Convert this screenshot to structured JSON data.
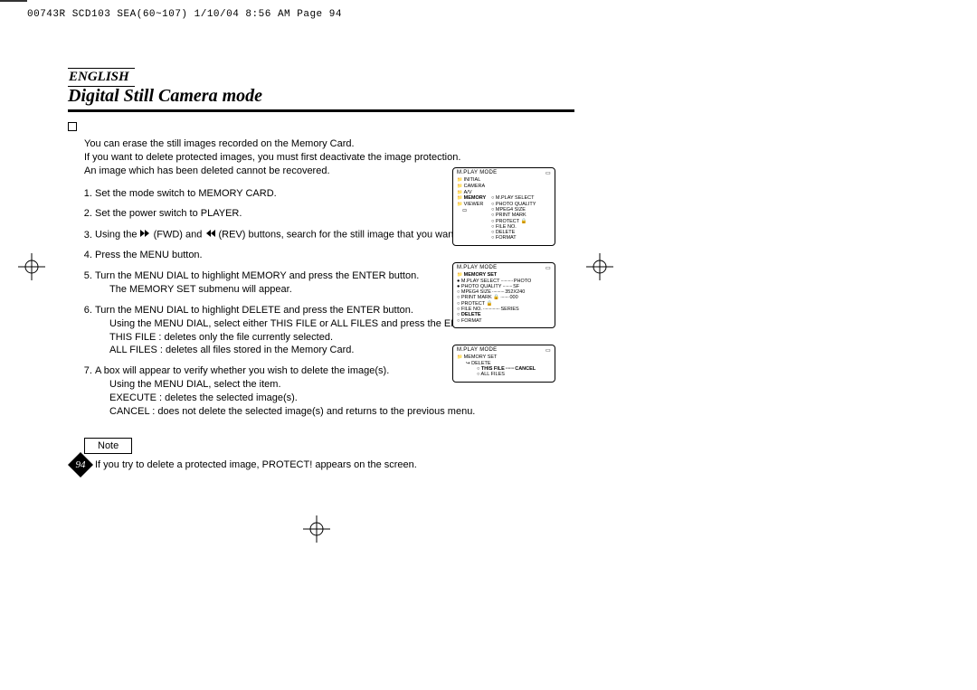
{
  "print_header": "00743R SCD103 SEA(60~107)   1/10/04 8:56 AM  Page 94",
  "language_label": "ENGLISH",
  "title": "Digital Still Camera mode",
  "intro_lines": [
    "You can erase the still images recorded on the Memory Card.",
    "If you want to delete protected images, you must first deactivate the image protection.",
    "An image which has been deleted cannot be recovered."
  ],
  "steps": {
    "s1": "Set the mode switch to MEMORY CARD.",
    "s2": "Set the power switch to PLAYER.",
    "s3_pre": "Using the ",
    "s3_fwd": "(FWD) and ",
    "s3_rev": "(REV) buttons, search for the still image that you want to delete.",
    "s4": "Press the MENU button.",
    "s5": "Turn the MENU DIAL to highlight MEMORY and press the ENTER button.",
    "s5_sub": "The MEMORY SET submenu will appear.",
    "s6": "Turn the MENU DIAL to highlight DELETE and press the ENTER button.",
    "s6_sub1": "Using the MENU DIAL, select either THIS FILE or ALL FILES and press the ENTER button.",
    "s6_sub2": "THIS FILE : deletes only the file currently selected.",
    "s6_sub3": "ALL FILES : deletes all files stored in the Memory Card.",
    "s7": "A box will appear to verify whether you wish to delete the image(s).",
    "s7_sub1": "Using the MENU DIAL, select the item.",
    "s7_sub2": "EXECUTE : deletes the selected image(s).",
    "s7_sub3": "CANCEL : does not delete the selected image(s) and returns to the previous menu."
  },
  "note_label": "Note",
  "note_text": "If you try to delete a protected image,  PROTECT!  appears on the screen.",
  "page_number": "94",
  "osd1": {
    "title": "M.PLAY MODE",
    "left_items": [
      "INITIAL",
      "CAMERA",
      "A/V"
    ],
    "memory_label": "MEMORY",
    "viewer_label": "VIEWER",
    "right_items": [
      "M.PLAY SELECT",
      "PHOTO QUALITY",
      "MPEG4 SIZE",
      "PRINT MARK",
      "PROTECT",
      "FILE NO.",
      "DELETE",
      "FORMAT"
    ]
  },
  "osd2": {
    "title": "M.PLAY MODE",
    "header": "MEMORY SET",
    "rows": [
      {
        "label": "M.PLAY SELECT",
        "value": "PHOTO"
      },
      {
        "label": "PHOTO QUALITY",
        "value": "SF"
      },
      {
        "label": "MPEG4 SIZE",
        "value": "352X240"
      },
      {
        "label": "PRINT MARK",
        "value": "000",
        "icon": "lock"
      },
      {
        "label": "PROTECT",
        "value": "",
        "icon": "lock"
      },
      {
        "label": "FILE NO.",
        "value": "SERIES"
      },
      {
        "label": "DELETE",
        "value": ""
      },
      {
        "label": "FORMAT",
        "value": ""
      }
    ]
  },
  "osd3": {
    "title": "M.PLAY MODE",
    "header": "MEMORY SET",
    "sub_header": "DELETE",
    "rows": [
      {
        "label": "THIS FILE",
        "value": "CANCEL"
      },
      {
        "label": "ALL FILES",
        "value": ""
      }
    ]
  }
}
